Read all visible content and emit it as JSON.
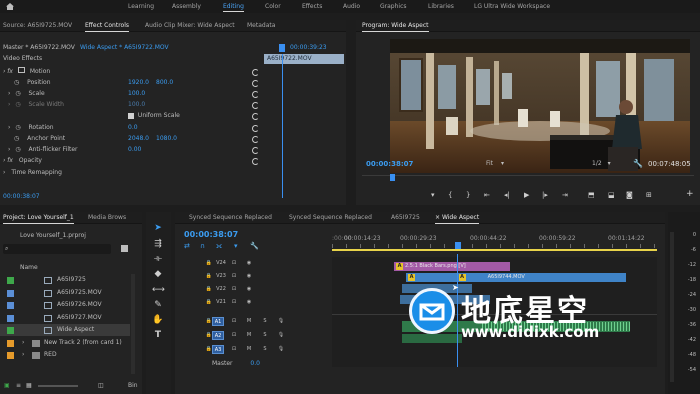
{
  "workspaces": [
    "Learning",
    "Assembly",
    "Editing",
    "Color",
    "Effects",
    "Audio",
    "Graphics",
    "Libraries",
    "LG Ultra Wide Workspace"
  ],
  "workspace_active": "Editing",
  "source_tabs": [
    "Source: A65I9725.MOV",
    "Effect Controls",
    "Audio Clip Mixer: Wide Aspect",
    "Metadata"
  ],
  "effect_controls": {
    "master": "Master * A65I9722.MOV",
    "sequence_clip": "Wide Aspect * A65I9722.MOV",
    "timecode_top": "00:00:39:23",
    "clip_label": "A65I9722.MOV",
    "section": "Video Effects",
    "motion_label": "Motion",
    "rows": [
      {
        "label": "Position",
        "v1": "1920.0",
        "v2": "800.0"
      },
      {
        "label": "Scale",
        "v1": "100.0",
        "v2": ""
      },
      {
        "label": "Scale Width",
        "v1": "100.0",
        "v2": ""
      },
      {
        "label": "Uniform Scale",
        "v1": "",
        "v2": ""
      },
      {
        "label": "Rotation",
        "v1": "0.0",
        "v2": ""
      },
      {
        "label": "Anchor Point",
        "v1": "2048.0",
        "v2": "1080.0"
      },
      {
        "label": "Anti-flicker Filter",
        "v1": "0.00",
        "v2": ""
      }
    ],
    "opacity_label": "Opacity",
    "time_remap_label": "Time Remapping",
    "timecode_bottom": "00:00:38:07"
  },
  "program": {
    "tab": "Program: Wide Aspect",
    "timecode": "00:00:38:07",
    "fit": "Fit",
    "resolution": "1/2",
    "duration": "00:07:48:05"
  },
  "project": {
    "tabs": [
      "Project: Love Yourself_1",
      "Media Brows"
    ],
    "file": "Love Yourself_1.prproj",
    "column_name": "Name",
    "items": [
      {
        "name": "A65I9725",
        "color": "#3ea84b",
        "kind": "seq"
      },
      {
        "name": "A65I9725.MOV",
        "color": "#5b8fd6",
        "kind": "clip"
      },
      {
        "name": "A65I9726.MOV",
        "color": "#5b8fd6",
        "kind": "clip"
      },
      {
        "name": "A65I9727.MOV",
        "color": "#5b8fd6",
        "kind": "clip"
      },
      {
        "name": "Wide Aspect",
        "color": "#3ea84b",
        "kind": "seq"
      },
      {
        "name": "New Track 2 (from card 1)",
        "color": "#e59a2b",
        "kind": "bin"
      },
      {
        "name": "RED",
        "color": "#e59a2b",
        "kind": "bin"
      }
    ],
    "bottom_label": "Bin"
  },
  "timeline": {
    "tabs": [
      "Synced Sequence Replaced",
      "Synced Sequence Replaced",
      "A65I9725",
      "Wide Aspect"
    ],
    "timecode": "00:00:38:07",
    "ruler": [
      "00:00:14:23",
      "00:00:29:23",
      "00:00:44:22",
      "00:00:59:22",
      "00:01:14:22"
    ],
    "video_tracks": [
      "V24",
      "V23",
      "V22",
      "V21"
    ],
    "audio_tracks": [
      "A1",
      "A2",
      "A3"
    ],
    "master_label": "Master",
    "master_value": "0.0",
    "clips": {
      "top": "2.5:1 Black Bars.png [V]",
      "main": "A65I9744.MOV"
    }
  },
  "meter_scale": [
    "0",
    "-6",
    "-12",
    "-18",
    "-24",
    "-30",
    "-36",
    "-42",
    "-48",
    "-54"
  ],
  "watermark": {
    "cn": "地底星空",
    "url": "www.didixk.com"
  },
  "colors": {
    "accent": "#2b8bf0",
    "timecode": "#3b9cf0",
    "playhead": "#3a8ff0"
  }
}
